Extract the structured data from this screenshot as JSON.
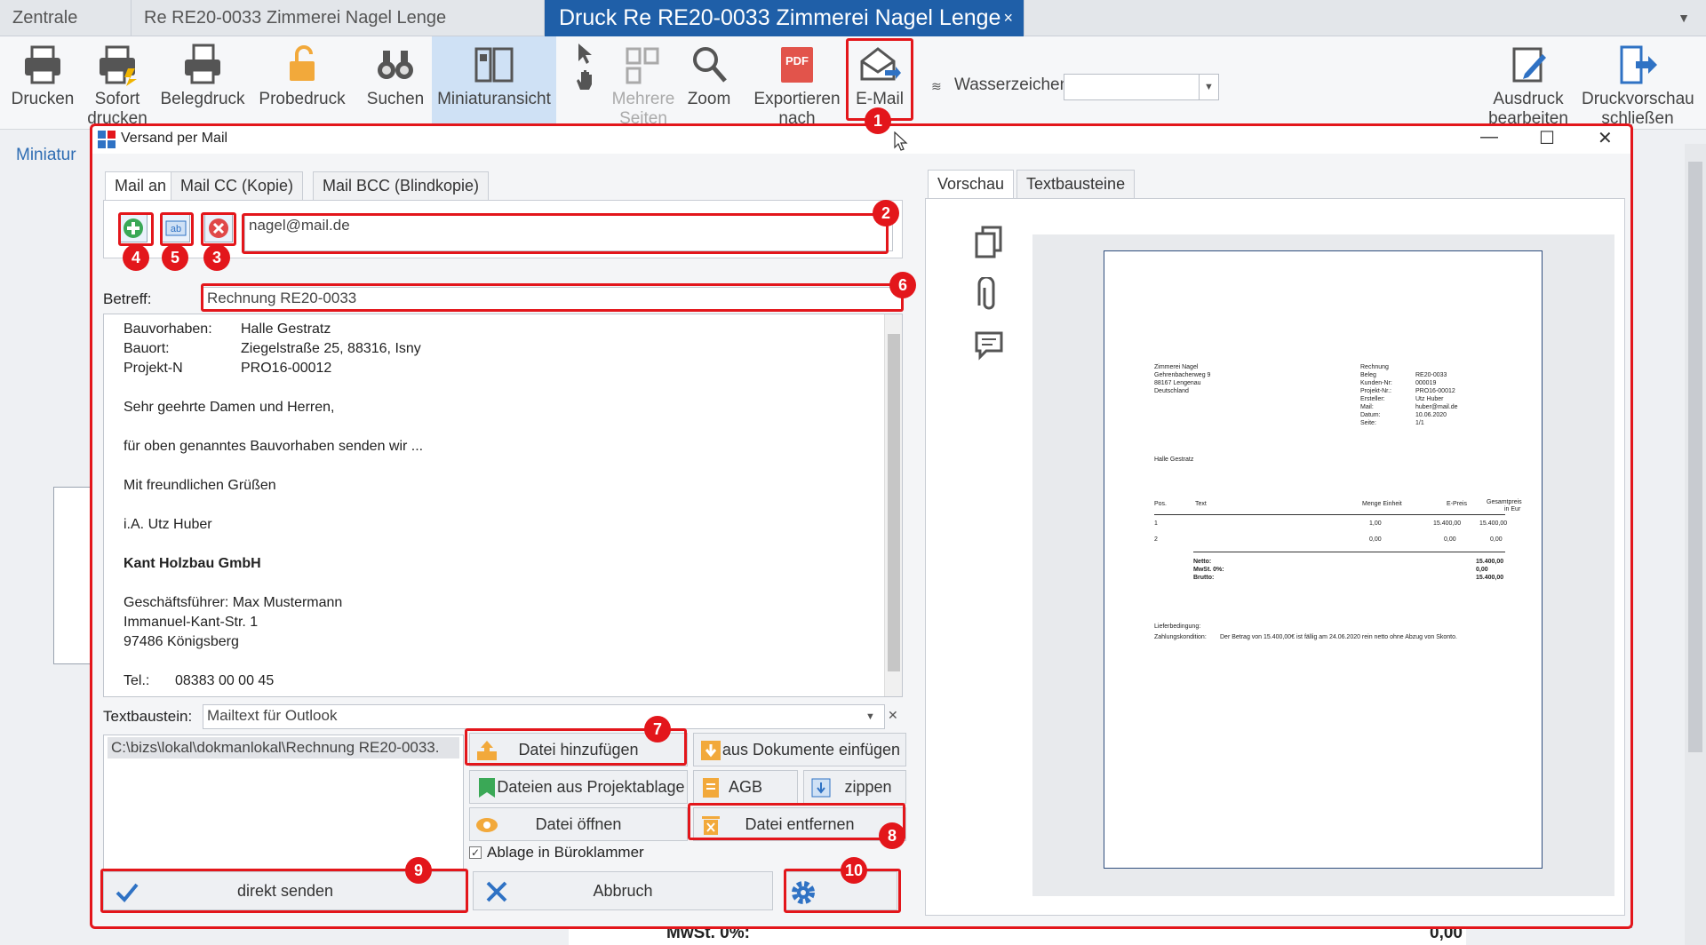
{
  "tabs": [
    {
      "label": "Zentrale"
    },
    {
      "label": "Re RE20-0033 Zimmerei Nagel Lenge"
    },
    {
      "label": "Druck Re RE20-0033 Zimmerei Nagel Lenge",
      "close": "×"
    }
  ],
  "ribbon": {
    "drucken": "Drucken",
    "sofort": "Sofort",
    "sofort2": "drucken",
    "belegdruck": "Belegdruck",
    "probedruck": "Probedruck",
    "suchen": "Suchen",
    "miniatur": "Miniaturansicht",
    "mehrere": "Mehrere",
    "mehrere2": "Seiten",
    "zoom": "Zoom",
    "exportieren": "Exportieren",
    "exportieren2": "nach",
    "email": "E-Mail",
    "wasserzeichen": "Wasserzeichen",
    "ausdruck": "Ausdruck",
    "ausdruck2": "bearbeiten",
    "druckvorschau": "Druckvorschau",
    "druckvorschau2": "schließen"
  },
  "behind": {
    "miniatur_label": "Miniatur",
    "bottom_text": "MwSt. 0%:",
    "bottom_value": "0,00"
  },
  "dialog": {
    "title": "Versand per Mail",
    "recipient_tabs": [
      "Mail an",
      "Mail CC (Kopie)",
      "Mail BCC (Blindkopie)"
    ],
    "recipient": "nagel@mail.de",
    "betreff_label": "Betreff:",
    "betreff": "Rechnung RE20-0033",
    "body": {
      "bauvorhaben_k": "Bauvorhaben:",
      "bauvorhaben_v": "Halle Gestratz",
      "bauort_k": "Bauort:",
      "bauort_v": "Ziegelstraße 25, 88316, Isny",
      "projekt_k": "Projekt-N",
      "projekt_v": "PRO16-00012",
      "greeting": "Sehr geehrte Damen und Herren,",
      "line1": "für oben genanntes Bauvorhaben senden wir ...",
      "closing": "Mit freundlichen Grüßen",
      "sign": "i.A. Utz Huber",
      "company": "Kant Holzbau GmbH",
      "gf": "Geschäftsführer: Max Mustermann",
      "street": "Immanuel-Kant-Str. 1",
      "city": "97486 Königsberg",
      "tel_k": "Tel.:",
      "tel_v": "08383 00 00 45"
    },
    "textbaustein_label": "Textbaustein:",
    "textbaustein": "Mailtext für Outlook",
    "attachment": "C:\\bizs\\lokal\\dokmanlokal\\Rechnung RE20-0033.",
    "buttons": {
      "datei_hinzufuegen": "Datei hinzufügen",
      "aus_dokumente": "aus Dokumente einfügen",
      "projektablage": "Dateien aus Projektablage",
      "agb": "AGB",
      "zippen": "zippen",
      "datei_oeffnen": "Datei öffnen",
      "datei_entfernen": "Datei entfernen",
      "ablage": "Ablage in Büroklammer",
      "direkt_senden": "direkt senden",
      "abbruch": "Abbruch"
    },
    "preview_tabs": [
      "Vorschau",
      "Textbausteine"
    ]
  },
  "preview_doc": {
    "sender": [
      "Zimmerei Nagel",
      "Gehrenbacherweg 9",
      "88167 Lengenau",
      "Deutschland"
    ],
    "meta_keys": [
      "Rechnung",
      "Beleg",
      "Kunden-Nr:",
      "Projekt-Nr.:",
      "Ersteller:",
      "Mail:",
      "Datum:",
      "Seite:"
    ],
    "meta_vals": [
      "",
      "RE20-0033",
      "000019",
      "PRO16-00012",
      "Utz Huber",
      "huber@mail.de",
      "10.06.2020",
      "1/1"
    ],
    "project": "Halle Gestratz",
    "cols": [
      "Pos.",
      "Text",
      "Menge Einheit",
      "E-Preis",
      "Gesamtpreis",
      "in Eur"
    ],
    "row1": [
      "1",
      "1,00",
      "15.400,00",
      "15.400,00"
    ],
    "row2": [
      "2",
      "0,00",
      "0,00",
      "0,00"
    ],
    "totals_k": [
      "Netto:",
      "MwSt. 0%:",
      "Brutto:"
    ],
    "totals_v": [
      "15.400,00",
      "0,00",
      "15.400,00"
    ],
    "liefer": "Lieferbedingung:",
    "zahlung_k": "Zahlungskondition:",
    "zahlung_v": "Der Betrag von 15.400,00€ ist fällig am 24.06.2020 rein netto ohne Abzug von Skonto."
  },
  "annotations": [
    "1",
    "2",
    "3",
    "4",
    "5",
    "6",
    "7",
    "8",
    "9",
    "10"
  ],
  "colors": {
    "accent": "#1f5fa8",
    "annotation": "#e3161b"
  }
}
